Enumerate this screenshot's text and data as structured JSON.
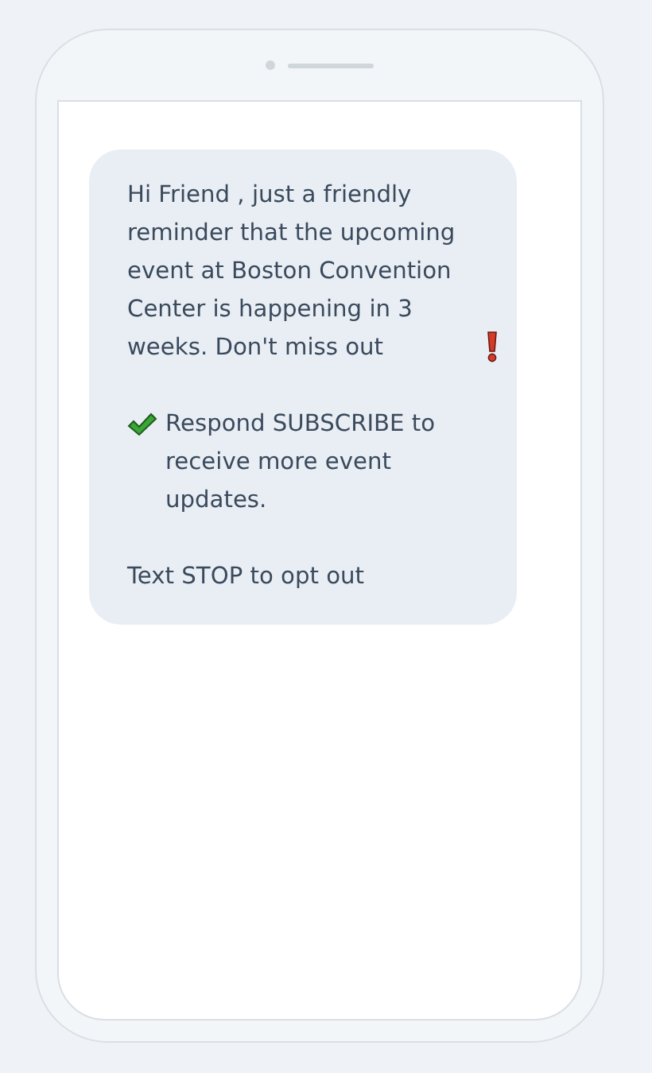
{
  "message": {
    "paragraphs": [
      {
        "kind": "alert",
        "text": "Hi Friend , just a friendly reminder that the upcoming event at Boston Convention Center is happening in 3 weeks. Don't miss out"
      },
      {
        "kind": "optin",
        "text": "Respond SUBSCRIBE to receive more event updates."
      },
      {
        "kind": "plain",
        "text": "Text STOP to opt out"
      }
    ]
  }
}
